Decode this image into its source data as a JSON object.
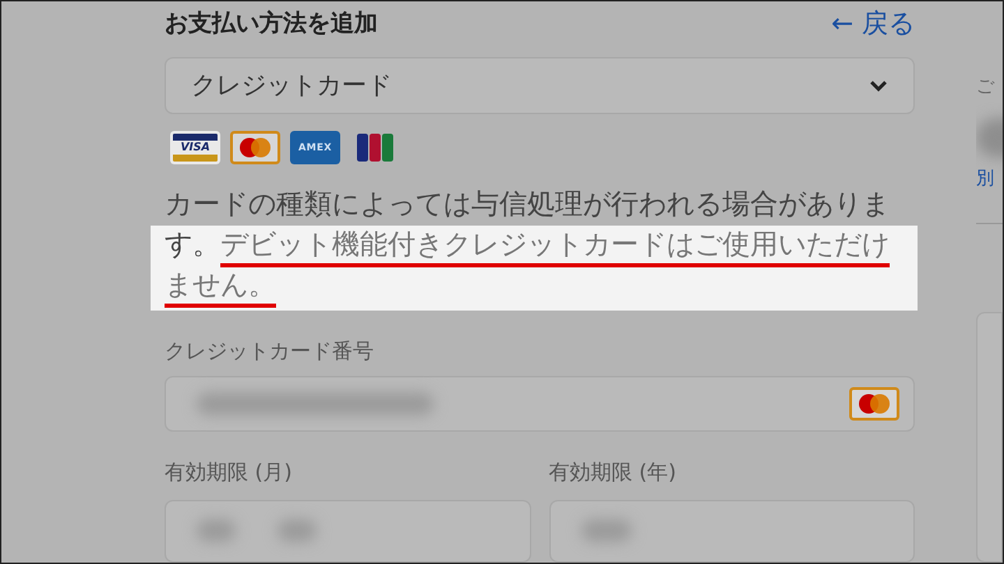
{
  "header": {
    "title": "お支払い方法を追加",
    "back_link": {
      "arrow": "←",
      "label": "戻る"
    }
  },
  "payment_method_select": {
    "value": "クレジットカード"
  },
  "card_brands": [
    {
      "kind": "visa",
      "label": "VISA",
      "selected": false
    },
    {
      "kind": "mastercard",
      "selected": true
    },
    {
      "kind": "amex",
      "label": "AMEX",
      "selected": false
    },
    {
      "kind": "jcb",
      "selected": false
    }
  ],
  "notice": {
    "lead": "カードの種類によっては与信処理が行われる場合があります。",
    "highlight": "デビット機能付きクレジットカードはご使用いただけません。"
  },
  "card_number": {
    "label": "クレジットカード番号",
    "brand_icon": {
      "kind": "mastercard"
    }
  },
  "expiry_month": {
    "label": "有効期限 (月)"
  },
  "expiry_year": {
    "label": "有効期限 (年)"
  },
  "right_panel": {
    "subtext": "ご",
    "link": "別"
  }
}
